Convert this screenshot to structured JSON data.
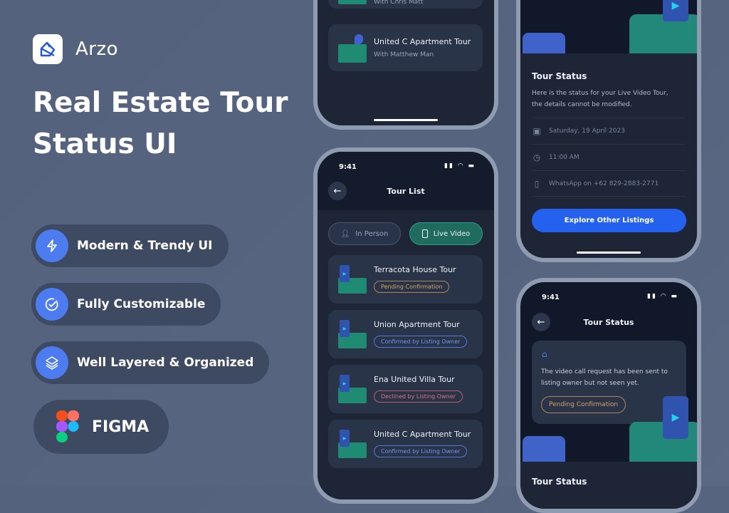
{
  "brand": {
    "name": "Arzo",
    "colors": {
      "background": "#55627e",
      "accent": "#4d7cf1",
      "teal": "#1f6b5e",
      "card": "#2a3449"
    }
  },
  "headline": "Real Estate Tour Status UI",
  "features": [
    {
      "icon": "lightning-icon",
      "label": "Modern & Trendy UI"
    },
    {
      "icon": "check-circle-icon",
      "label": "Fully Customizable"
    },
    {
      "icon": "layers-icon",
      "label": "Well Layered & Organized"
    }
  ],
  "figma_label": "FIGMA",
  "phone_a": {
    "cards": [
      {
        "title": "",
        "subtitle": "With Chris Matt"
      },
      {
        "title": "United C Apartment Tour",
        "subtitle": "With Matthew Man"
      }
    ]
  },
  "tour_list": {
    "time": "9:41",
    "title": "Tour List",
    "tabs": [
      {
        "label": "In Person",
        "active": false
      },
      {
        "label": "Live Video",
        "active": true
      }
    ],
    "items": [
      {
        "title": "Terracota House Tour",
        "status": "Pending Confirmation",
        "kind": "pending"
      },
      {
        "title": "Union Apartment Tour",
        "status": "Confirmed by Listing Owner",
        "kind": "confirmed"
      },
      {
        "title": "Ena United Villa Tour",
        "status": "Declined by Listing Owner",
        "kind": "declined"
      },
      {
        "title": "United C Apartment Tour",
        "status": "Confirmed by Listing Owner",
        "kind": "confirmed"
      }
    ]
  },
  "tour_status_details": {
    "title": "Tour Status",
    "description": "Here is the status for your Live Video Tour, the details cannot be modified.",
    "date": "Saturday, 19 April 2023",
    "time": "11:00 AM",
    "contact": "WhatsApp on +62 829-2883-2771",
    "button": "Explore Other Listings"
  },
  "tour_status": {
    "time": "9:41",
    "title": "Tour Status",
    "message": "The video call request has been sent to listing owner but not seen yet.",
    "status": "Pending Confirmation",
    "section_title": "Tour Status"
  }
}
